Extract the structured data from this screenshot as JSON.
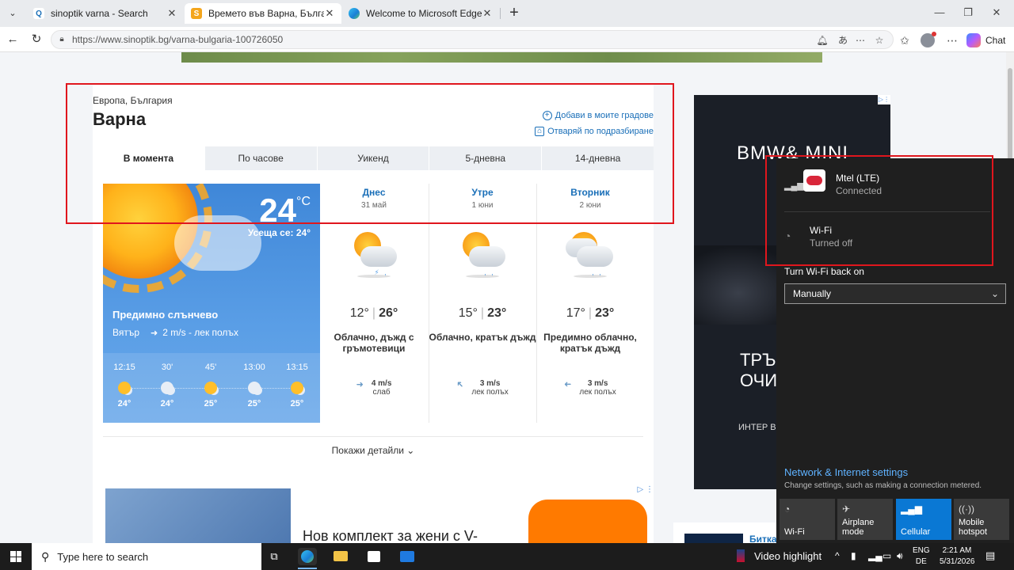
{
  "browser": {
    "tabs": [
      {
        "title": "sinoptik varna - Search",
        "active": false
      },
      {
        "title": "Времето във Варна, България - S",
        "active": true
      },
      {
        "title": "Welcome to Microsoft Edge",
        "active": false
      }
    ],
    "new_tab": "+",
    "url": "https://www.sinoptik.bg/varna-bulgaria-100726050",
    "chat_label": "Chat"
  },
  "page": {
    "region": "Европа, България",
    "city": "Варна",
    "add_link": "Добави в моите градове",
    "default_link": "Отваряй по подразбиране",
    "tabs": [
      "В момента",
      "По часове",
      "Уикенд",
      "5-дневна",
      "14-дневна"
    ],
    "now": {
      "temp": "24",
      "unit": "°C",
      "feels": "Усеща се: 24°",
      "condition": "Предимно слънчево",
      "wind_label": "Вятър",
      "wind_value": "2 m/s - лек полъх",
      "hourly": [
        {
          "time": "12:15",
          "temp": "24°"
        },
        {
          "time": "30'",
          "temp": "24°"
        },
        {
          "time": "45'",
          "temp": "25°"
        },
        {
          "time": "13:00",
          "temp": "25°"
        },
        {
          "time": "13:15",
          "temp": "25°"
        }
      ]
    },
    "days": [
      {
        "name": "Днес",
        "date": "31 май",
        "low": "12°",
        "high": "26°",
        "desc": "Облачно, дъжд с гръмотевици",
        "wind": "4 m/s",
        "wind_desc": "слаб"
      },
      {
        "name": "Утре",
        "date": "1 юни",
        "low": "15°",
        "high": "23°",
        "desc": "Облачно, кратък дъжд",
        "wind": "3 m/s",
        "wind_desc": "лек полъх"
      },
      {
        "name": "Вторник",
        "date": "2 юни",
        "low": "17°",
        "high": "23°",
        "desc": "Предимно облачно, кратък дъжд",
        "wind": "3 m/s",
        "wind_desc": "лек полъх"
      }
    ],
    "details": "Покажи детайли",
    "ad_right": {
      "brand": "BMW& MINI",
      "line1": "ТРЪ",
      "line2": "ОЧИ",
      "line3": "ИНТЕР В"
    },
    "ad_bottom": {
      "headline": "Нов комплект за жени с V-"
    },
    "ad_bottom2": {
      "text": "Битка"
    }
  },
  "network": {
    "cellular": {
      "name": "Mtel (LTE)",
      "status": "Connected"
    },
    "wifi": {
      "name": "Wi-Fi",
      "status": "Turned off"
    },
    "turn_on_label": "Turn Wi-Fi back on",
    "turn_on_value": "Manually",
    "settings_link": "Network & Internet settings",
    "settings_desc": "Change settings, such as making a connection metered.",
    "quick_actions": [
      {
        "label": "Wi-Fi",
        "on": false
      },
      {
        "label": "Airplane mode",
        "on": false
      },
      {
        "label": "Cellular",
        "on": true
      },
      {
        "label": "Mobile hotspot",
        "on": false
      }
    ]
  },
  "taskbar": {
    "search_placeholder": "Type here to search",
    "video_highlight": "Video highlight",
    "lang1": "ENG",
    "lang2": "DE",
    "time": "2:21 AM",
    "date": "5/31/2026"
  }
}
